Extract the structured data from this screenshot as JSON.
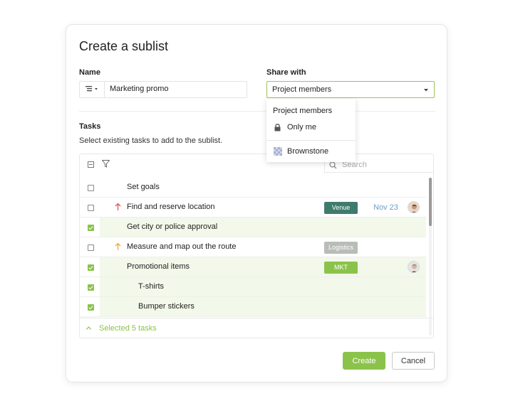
{
  "dialog": {
    "title": "Create a sublist",
    "name_label": "Name",
    "name_value": "Marketing promo",
    "share_label": "Share with",
    "share_value": "Project members",
    "share_options": [
      "Project members",
      "Only me",
      "Brownstone"
    ],
    "tasks_label": "Tasks",
    "tasks_hint": "Select existing tasks to add to the sublist.",
    "search_placeholder": "Search",
    "tasks": [
      {
        "name": "Set goals",
        "checked": false,
        "priority": "",
        "tag": "",
        "date": "",
        "avatar": false,
        "indent": 0
      },
      {
        "name": "Find and reserve location",
        "checked": false,
        "priority": "high",
        "tag": "Venue",
        "tag_color": "#3f7b6c",
        "date": "Nov 23",
        "avatar": true,
        "indent": 0
      },
      {
        "name": "Get city or police approval",
        "checked": true,
        "priority": "",
        "tag": "",
        "date": "",
        "avatar": false,
        "indent": 0
      },
      {
        "name": "Measure and map out the route",
        "checked": false,
        "priority": "medium",
        "tag": "Logistics",
        "tag_color": "#b8bdb8",
        "date": "",
        "avatar": false,
        "indent": 0
      },
      {
        "name": "Promotional items",
        "checked": true,
        "priority": "",
        "tag": "MKT",
        "tag_color": "#8bc34a",
        "date": "",
        "avatar": true,
        "indent": 0
      },
      {
        "name": "T-shirts",
        "checked": true,
        "priority": "",
        "tag": "",
        "date": "",
        "avatar": false,
        "indent": 1
      },
      {
        "name": "Bumper stickers",
        "checked": true,
        "priority": "",
        "tag": "",
        "date": "",
        "avatar": false,
        "indent": 1
      }
    ],
    "selected_summary": "Selected 5 tasks",
    "create_label": "Create",
    "cancel_label": "Cancel",
    "colors": {
      "accent": "#8bc34a",
      "high_priority": "#e0554f",
      "medium_priority": "#f0a830",
      "date": "#6a9ec9"
    }
  }
}
